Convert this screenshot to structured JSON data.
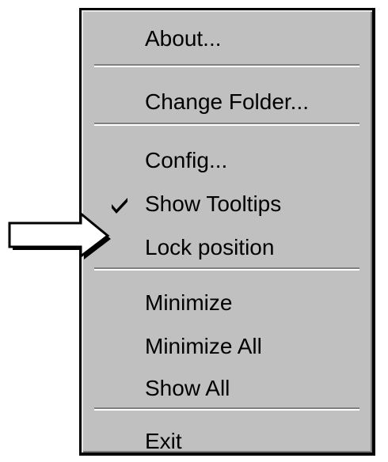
{
  "menu": {
    "groups": [
      {
        "items": [
          {
            "label": "About..."
          }
        ]
      },
      {
        "items": [
          {
            "label": "Change Folder..."
          }
        ]
      },
      {
        "items": [
          {
            "label": "Config..."
          },
          {
            "label": "Show Tooltips",
            "checked": true
          },
          {
            "label": "Lock position"
          }
        ]
      },
      {
        "items": [
          {
            "label": "Minimize"
          },
          {
            "label": "Minimize All"
          },
          {
            "label": "Show All"
          }
        ]
      },
      {
        "items": [
          {
            "label": "Exit"
          }
        ]
      }
    ]
  },
  "pointer": {
    "icon": "right-arrow-icon",
    "target": "Lock position"
  },
  "colors": {
    "menu_bg": "#c0c0c0",
    "text": "#000000",
    "separator_dark": "#808080",
    "separator_light": "#ffffff"
  }
}
